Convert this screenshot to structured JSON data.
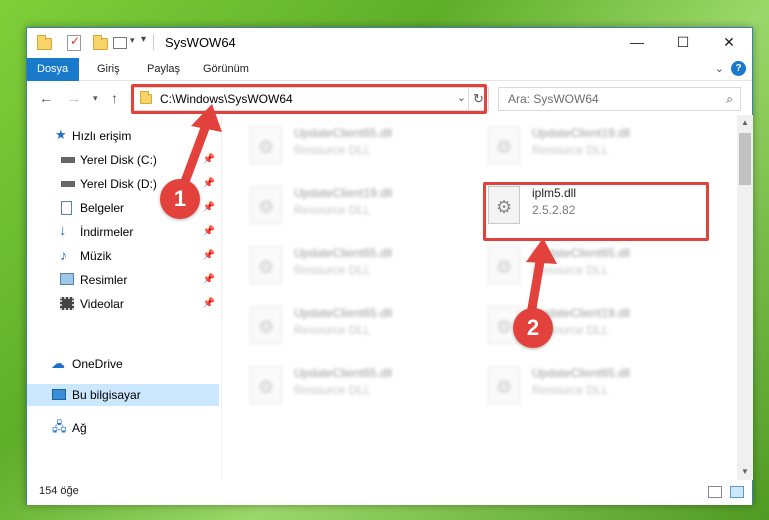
{
  "window": {
    "title": "SysWOW64"
  },
  "ribbon": {
    "tabs": [
      "Dosya",
      "Giriş",
      "Paylaş",
      "Görünüm"
    ],
    "help": "?"
  },
  "nav": {
    "address": "C:\\Windows\\SysWOW64",
    "search_placeholder": "Ara: SysWOW64"
  },
  "sidebar": {
    "quick_access": "Hızlı erişim",
    "items": [
      {
        "label": "Yerel Disk (C:)",
        "icon": "drive-icon"
      },
      {
        "label": "Yerel Disk (D:)",
        "icon": "drive-icon"
      },
      {
        "label": "Belgeler",
        "icon": "documents-icon"
      },
      {
        "label": "İndirmeler",
        "icon": "download-icon"
      },
      {
        "label": "Müzik",
        "icon": "music-icon"
      },
      {
        "label": "Resimler",
        "icon": "pictures-icon"
      },
      {
        "label": "Videolar",
        "icon": "video-icon"
      }
    ],
    "onedrive": "OneDrive",
    "this_pc": "Bu bilgisayar",
    "network": "Ağ"
  },
  "files": {
    "left": [
      {
        "name": "UpdateClient65.dll",
        "desc": "Resource DLL"
      },
      {
        "name": "UpdateClient19.dll",
        "desc": "Resource DLL"
      },
      {
        "name": "UpdateClient65.dll",
        "desc": "Resource DLL"
      },
      {
        "name": "UpdateClient65.dll",
        "desc": "Resource DLL"
      },
      {
        "name": "UpdateClient65.dll",
        "desc": "Resource DLL"
      }
    ],
    "right": [
      {
        "name": "UpdateClient19.dll",
        "desc": "Resource DLL"
      },
      {
        "name": "iplm5.dll",
        "desc": "2.5.2.82"
      },
      {
        "name": "UpdateClient65.dll",
        "desc": "Resource DLL"
      },
      {
        "name": "UpdateClient19.dll",
        "desc": "Resource DLL"
      },
      {
        "name": "UpdateClient65.dll",
        "desc": "Resource DLL"
      }
    ]
  },
  "status": {
    "count": "154 öğe"
  },
  "annotations": {
    "badge1": "1",
    "badge2": "2",
    "color": "#e3413c"
  }
}
